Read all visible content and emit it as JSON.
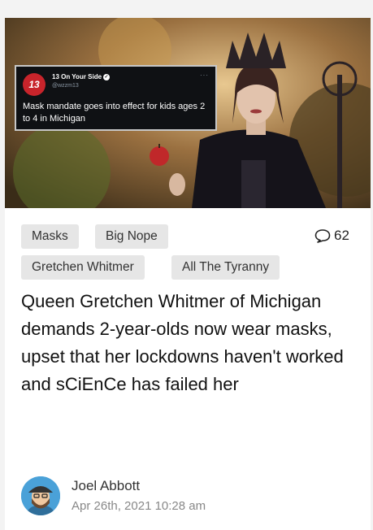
{
  "tweet": {
    "logo_text": "13",
    "account_name": "13 On Your Side",
    "handle": "@wzzm13",
    "more": "···",
    "text": "Mask mandate goes into effect for kids ages 2 to 4 in Michigan"
  },
  "tags": [
    "Masks",
    "Big Nope",
    "Gretchen Whitmer",
    "All The Tyranny"
  ],
  "comments": {
    "count": "62",
    "icon": "comment-bubble-icon"
  },
  "headline": "Queen Gretchen Whitmer of Michigan demands 2-year-olds now wear masks, upset that her lockdowns haven't worked and sCiEnCe has failed her",
  "author": {
    "name": "Joel Abbott",
    "date": "Apr 26th, 2021 10:28 am"
  },
  "colors": {
    "tag_bg": "#e6e6e6",
    "tweet_bg": "#0f1114",
    "logo_red": "#c8242b"
  }
}
